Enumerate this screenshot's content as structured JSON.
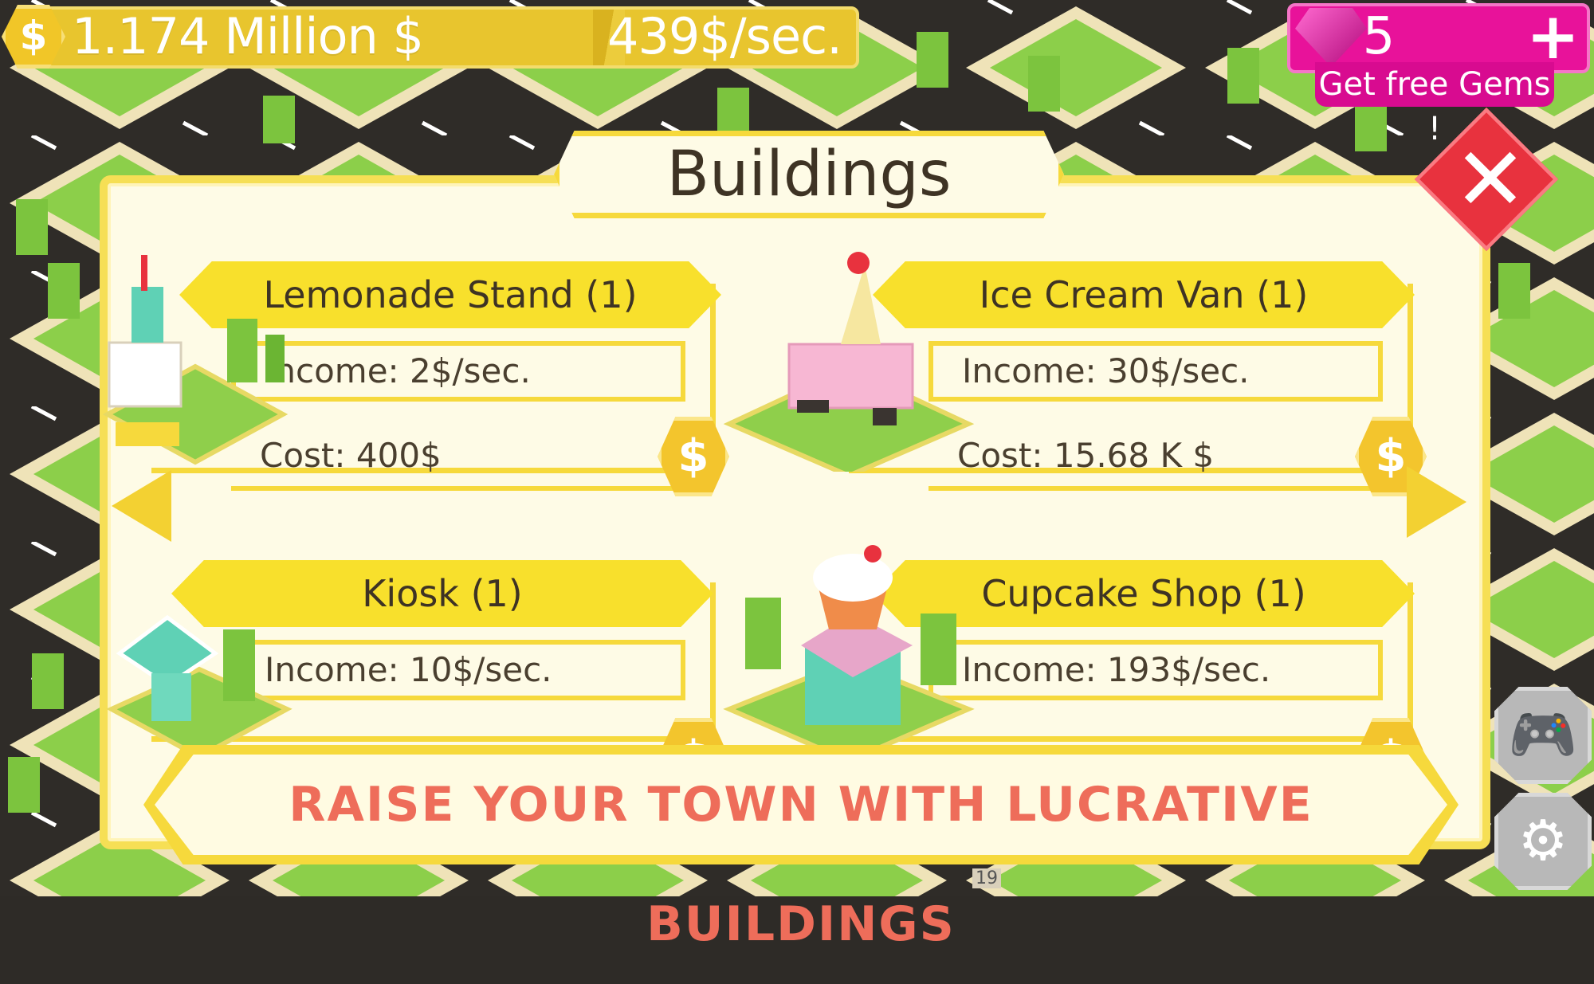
{
  "hud": {
    "currency_icon": "dollar-coin-icon",
    "money": "1.174 Million $",
    "income_rate": "439$/sec.",
    "gems_count": "5",
    "gems_plus": "+",
    "get_free_gems": "Get free Gems !"
  },
  "panel": {
    "title": "Buildings",
    "close_icon": "close-icon",
    "buy_symbol": "$"
  },
  "buildings": [
    {
      "name": "Lemonade Stand (1)",
      "income": "Income: 2$/sec.",
      "cost": "Cost: 400$",
      "art": "lemonade-stand-icon"
    },
    {
      "name": "Ice Cream Van (1)",
      "income": "Income: 30$/sec.",
      "cost": "Cost: 15.68 K $",
      "art": "ice-cream-van-icon"
    },
    {
      "name": "Kiosk (1)",
      "income": "Income: 10$/sec.",
      "cost": "",
      "art": "kiosk-icon"
    },
    {
      "name": "Cupcake Shop (1)",
      "income": "Income: 193$/sec.",
      "cost": "",
      "art": "cupcake-shop-icon"
    }
  ],
  "banner": {
    "text": "RAISE YOUR TOWN WITH LUCRATIVE BUILDINGS"
  },
  "side_buttons": [
    {
      "icon": "gamepad-icon"
    },
    {
      "icon": "settings-gear-icon"
    }
  ],
  "map_label": "19",
  "colors": {
    "gold": "#e8c52e",
    "panel_border": "#f6d93c",
    "gem_pink": "#e8129a",
    "close_red": "#e8323e",
    "banner_text": "#ee6d5a"
  }
}
